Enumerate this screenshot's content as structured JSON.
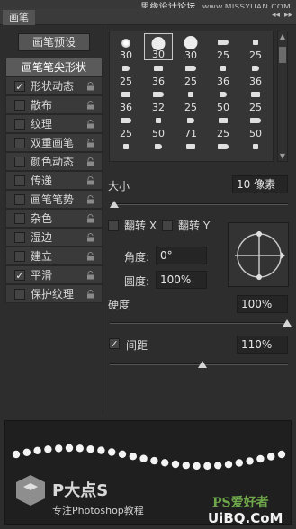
{
  "watermark_top": {
    "text": "思缘设计论坛",
    "site": "www.MISSYUAN.COM"
  },
  "tab": {
    "label": "画笔"
  },
  "presets_button": "画笔预设",
  "brush_tip_shape": "画笔笔尖形状",
  "options": [
    {
      "label": "形状动态",
      "checked": true,
      "check_mark": "✓"
    },
    {
      "label": "散布",
      "checked": false,
      "check_mark": ""
    },
    {
      "label": "纹理",
      "checked": false,
      "check_mark": ""
    },
    {
      "label": "双重画笔",
      "checked": false,
      "check_mark": ""
    },
    {
      "label": "颜色动态",
      "checked": false,
      "check_mark": ""
    },
    {
      "label": "传递",
      "checked": false,
      "check_mark": ""
    },
    {
      "label": "画笔笔势",
      "checked": false,
      "check_mark": ""
    },
    {
      "label": "杂色",
      "checked": false,
      "check_mark": ""
    },
    {
      "label": "湿边",
      "checked": false,
      "check_mark": ""
    },
    {
      "label": "建立",
      "checked": false,
      "check_mark": ""
    },
    {
      "label": "平滑",
      "checked": true,
      "check_mark": "✓"
    },
    {
      "label": "保护纹理",
      "checked": false,
      "check_mark": ""
    }
  ],
  "brush_tips": [
    [
      "30",
      "30",
      "30",
      "25",
      "25"
    ],
    [
      "25",
      "36",
      "25",
      "36",
      "36"
    ],
    [
      "36",
      "32",
      "25",
      "50",
      "25"
    ],
    [
      "25",
      "50",
      "71",
      "25",
      "50"
    ],
    [
      "",
      "",
      "",
      "",
      ""
    ]
  ],
  "selected_tip": {
    "row": 0,
    "col": 1
  },
  "size": {
    "label": "大小",
    "value": "10 像素"
  },
  "flip_x": {
    "label": "翻转 X"
  },
  "flip_y": {
    "label": "翻转 Y"
  },
  "angle": {
    "label": "角度:",
    "value": "0°"
  },
  "roundness": {
    "label": "圆度:",
    "value": "100%"
  },
  "hardness": {
    "label": "硬度",
    "value": "100%"
  },
  "spacing": {
    "label": "间距",
    "value": "110%",
    "checked": true,
    "check_mark": "✓"
  },
  "watermark_bottom": {
    "brand": "P大点S",
    "caption": "专注Photoshop教程",
    "ps_logo": "PS爱好者",
    "uibq": "UiBQ.CoM"
  }
}
